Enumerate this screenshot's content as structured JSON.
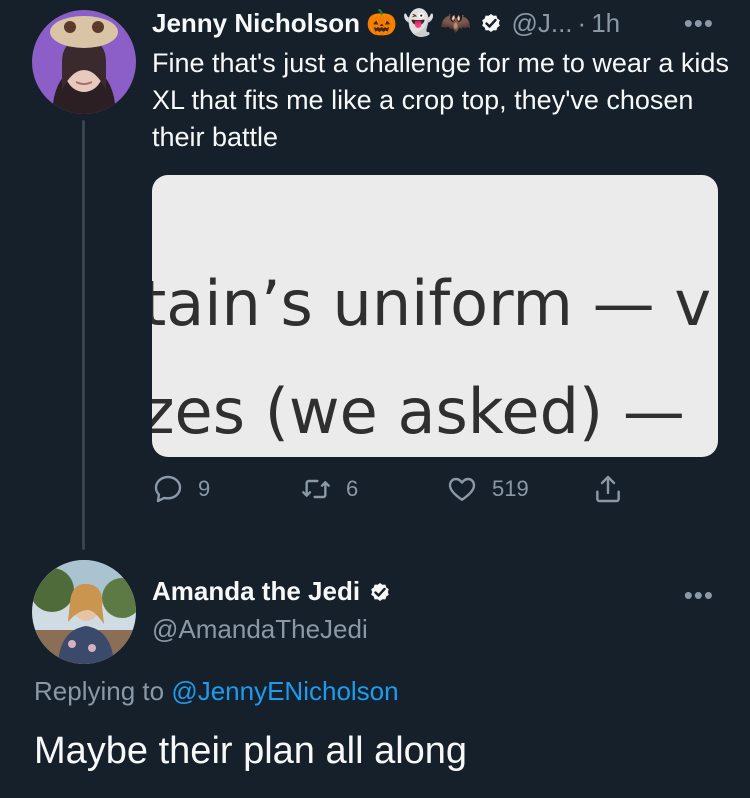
{
  "tweet1": {
    "name": "Jenny Nicholson",
    "emojis": [
      "🎃",
      "👻",
      "🦇"
    ],
    "handle": "@J...",
    "separator": "·",
    "time": "1h",
    "more": "•••",
    "text": "Fine that's just a challenge for me to wear a kids XL that fits me like a crop top, they've chosen their battle",
    "media": {
      "line1": "tain’s uniform — v",
      "line2": "zes (we asked) —"
    },
    "actions": {
      "replies": "9",
      "retweets": "6",
      "likes": "519"
    }
  },
  "tweet2": {
    "name": "Amanda the Jedi",
    "handle": "@AmandaTheJedi",
    "more": "•••",
    "replying_prefix": "Replying to",
    "replying_mention": "@JennyENicholson",
    "text": "Maybe their plan all along"
  },
  "colors": {
    "background": "#15202b",
    "muted": "#8b98a5",
    "accent": "#1d9bf0",
    "text": "#f7f9f9"
  },
  "icons": [
    "reply-icon",
    "retweet-icon",
    "like-icon",
    "share-icon",
    "verified-badge-icon",
    "more-icon"
  ]
}
